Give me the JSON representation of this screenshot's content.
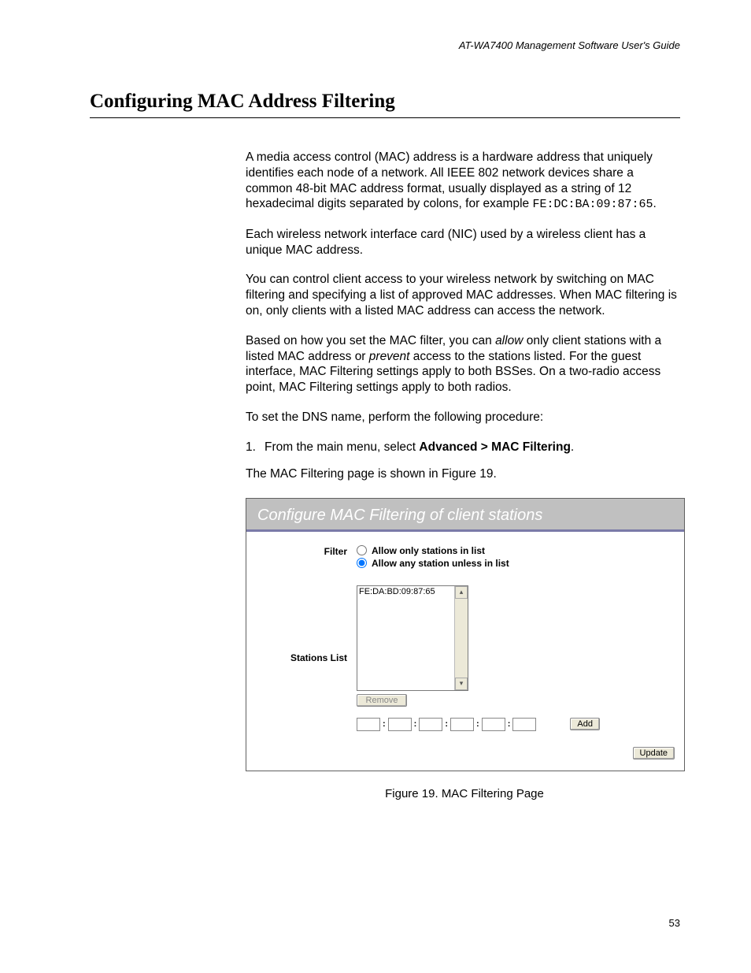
{
  "header": {
    "guide_title": "AT-WA7400 Management Software User's Guide"
  },
  "section": {
    "title": "Configuring MAC Address Filtering"
  },
  "paragraphs": {
    "p1a": "A media access control (",
    "p1b": "MAC",
    "p1c": ") address is a hardware address that uniquely identifies each node of a network. All IEEE 802 network devices share a common 48-bit MAC address format, usually displayed as a string of 12 hexadecimal digits separated by colons, for example ",
    "p1_example": "FE:DC:BA:09:87:65",
    "p1d": ".",
    "p2a": "Each wireless network interface card (",
    "p2b": "NIC",
    "p2c": ") used by a wireless client has a unique MAC address.",
    "p3": "You can control client access to your wireless network by switching on MAC filtering and specifying a list of approved MAC addresses. When MAC filtering is on, only clients with a listed MAC address can access the network.",
    "p4a": "Based on how you set the MAC filter, you can ",
    "p4_allow": "allow",
    "p4b": " only client stations with a listed MAC address or ",
    "p4_prevent": "prevent",
    "p4c": " access to the stations listed. For the guest interface, ",
    "p4d": "MAC",
    "p4e": " Filtering settings apply to both ",
    "p4f": "BSS",
    "p4g": "es. On a two-radio access point, MAC Filtering settings apply to both radios.",
    "p5": "To set the DNS name, perform the following procedure:",
    "step1_num": "1.",
    "step1a": "From the main menu, select ",
    "step1b": "Advanced > MAC Filtering",
    "step1c": ".",
    "step1_sub": "The MAC Filtering page is shown in Figure 19."
  },
  "figure": {
    "header": "Configure MAC Filtering of client stations",
    "labels": {
      "filter": "Filter",
      "stations_list": "Stations List"
    },
    "radio": {
      "allow_only": "Allow only stations in list",
      "allow_any": "Allow any station unless in list"
    },
    "list_item": "FE:DA:BD:09:87:65",
    "buttons": {
      "remove": "Remove",
      "add": "Add",
      "update": "Update"
    },
    "mac_sep": ":",
    "caption": "Figure 19. MAC Filtering Page"
  },
  "page_number": "53"
}
